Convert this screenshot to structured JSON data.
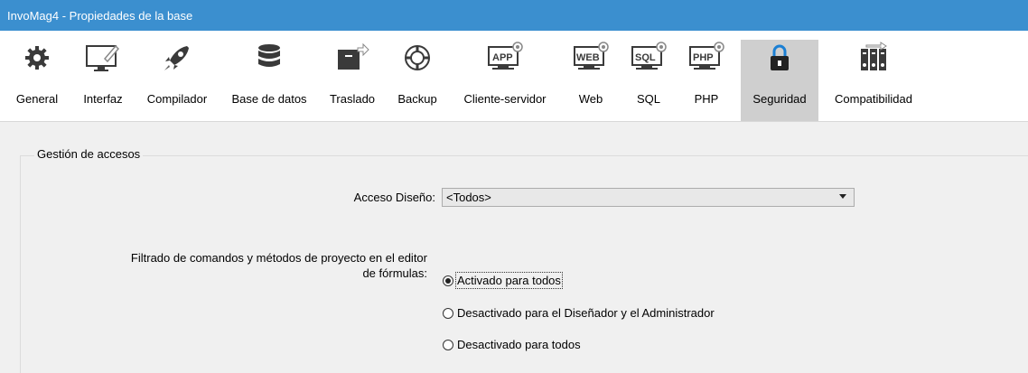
{
  "window": {
    "title": "InvoMag4 - Propiedades de la base"
  },
  "toolbar": {
    "items": [
      {
        "label": "General",
        "icon": "gear-icon"
      },
      {
        "label": "Interfaz",
        "icon": "monitor-pencil-icon"
      },
      {
        "label": "Compilador",
        "icon": "rocket-icon"
      },
      {
        "label": "Base de datos",
        "icon": "database-icon"
      },
      {
        "label": "Traslado",
        "icon": "box-arrow-icon"
      },
      {
        "label": "Backup",
        "icon": "lifebuoy-icon"
      },
      {
        "label": "Cliente-servidor",
        "icon": "app-server-icon",
        "badge": "APP"
      },
      {
        "label": "Web",
        "icon": "web-server-icon",
        "badge": "WEB"
      },
      {
        "label": "SQL",
        "icon": "sql-server-icon",
        "badge": "SQL"
      },
      {
        "label": "PHP",
        "icon": "php-server-icon",
        "badge": "PHP"
      },
      {
        "label": "Seguridad",
        "icon": "lock-icon",
        "active": true
      },
      {
        "label": "Compatibilidad",
        "icon": "compatibility-icon"
      }
    ]
  },
  "access": {
    "group_title": "Gestión de accesos",
    "design_label": "Acceso Diseño:",
    "design_value": "<Todos>",
    "filter_label_line1": "Filtrado de comandos y métodos de proyecto en el editor",
    "filter_label_line2": "de fórmulas:",
    "options": [
      {
        "label": "Activado para todos",
        "selected": true
      },
      {
        "label": "Desactivado para el Diseñador y el Administrador",
        "selected": false
      },
      {
        "label": "Desactivado para todos",
        "selected": false
      }
    ]
  }
}
